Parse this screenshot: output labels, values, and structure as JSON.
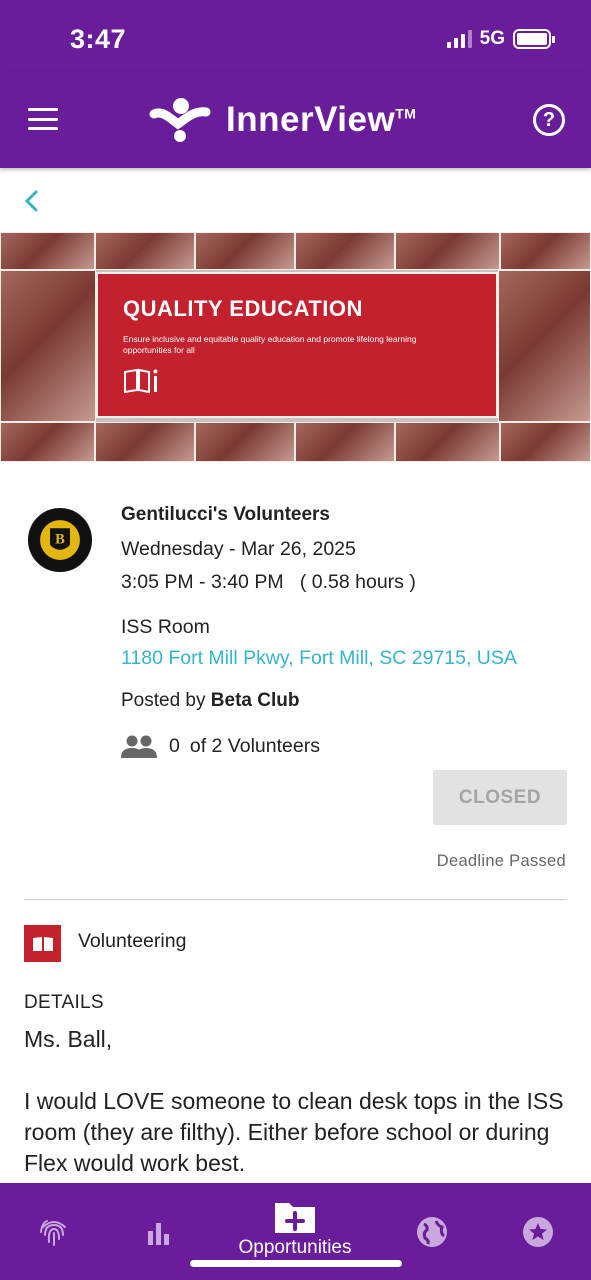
{
  "status_bar": {
    "time": "3:47",
    "network": "5G"
  },
  "app_bar": {
    "logo_text": "InnerView",
    "logo_tm": "TM"
  },
  "banner": {
    "title": "QUALITY EDUCATION",
    "subtitle": "Ensure inclusive and equitable quality education and promote lifelong learning opportunities for all"
  },
  "event": {
    "org_name": "Gentilucci's Volunteers",
    "date": "Wednesday - Mar 26, 2025",
    "time_range": "3:05 PM - 3:40 PM",
    "duration": "( 0.58 hours )",
    "location_name": "ISS Room",
    "address": "1180 Fort Mill Pkwy, Fort Mill, SC 29715, USA",
    "posted_by_label": "Posted by",
    "posted_by": "Beta Club",
    "volunteers_count": "0",
    "volunteers_of": "of 2 Volunteers",
    "status_button": "CLOSED",
    "deadline_text": "Deadline Passed"
  },
  "category": {
    "label": "Volunteering"
  },
  "details": {
    "heading": "DETAILS",
    "paragraphs": [
      "Ms. Ball,",
      "I would LOVE someone to clean desk tops in the ISS room (they are filthy). Either before school or during Flex would work best."
    ]
  },
  "bottom_nav": {
    "items": [
      {
        "icon": "fingerprint-icon"
      },
      {
        "icon": "bar-chart-icon"
      },
      {
        "icon": "folder-plus-icon",
        "label": "Opportunities",
        "active": true
      },
      {
        "icon": "globe-icon"
      },
      {
        "icon": "star-badge-icon"
      }
    ]
  },
  "colors": {
    "brand_purple": "#6a1d9a",
    "link_teal": "#36b5c9",
    "banner_red": "#c4212f"
  }
}
